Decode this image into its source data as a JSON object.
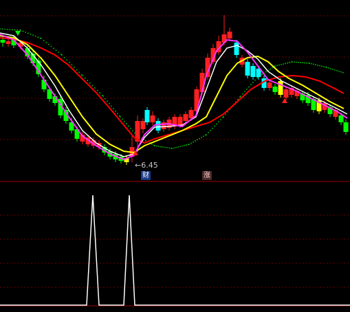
{
  "chart_data": [
    {
      "type": "candlestick",
      "annotations": {
        "low_price_label": "←6.45",
        "markers": [
          "财",
          "涨"
        ]
      },
      "ma_lines": [
        {
          "color": "#ff00ff"
        },
        {
          "color": "#ffffff"
        },
        {
          "color": "#ffff00"
        },
        {
          "color": "#ff0000"
        },
        {
          "color": "#00ff00",
          "style": "dotted"
        }
      ],
      "candle_colors": {
        "up": "#ff2020",
        "down": "#00ffff",
        "bull_solid": "#00ff00",
        "highlight": "#ffff00"
      }
    },
    {
      "type": "line",
      "spikes": 2,
      "line_color": "#ffffff"
    }
  ]
}
